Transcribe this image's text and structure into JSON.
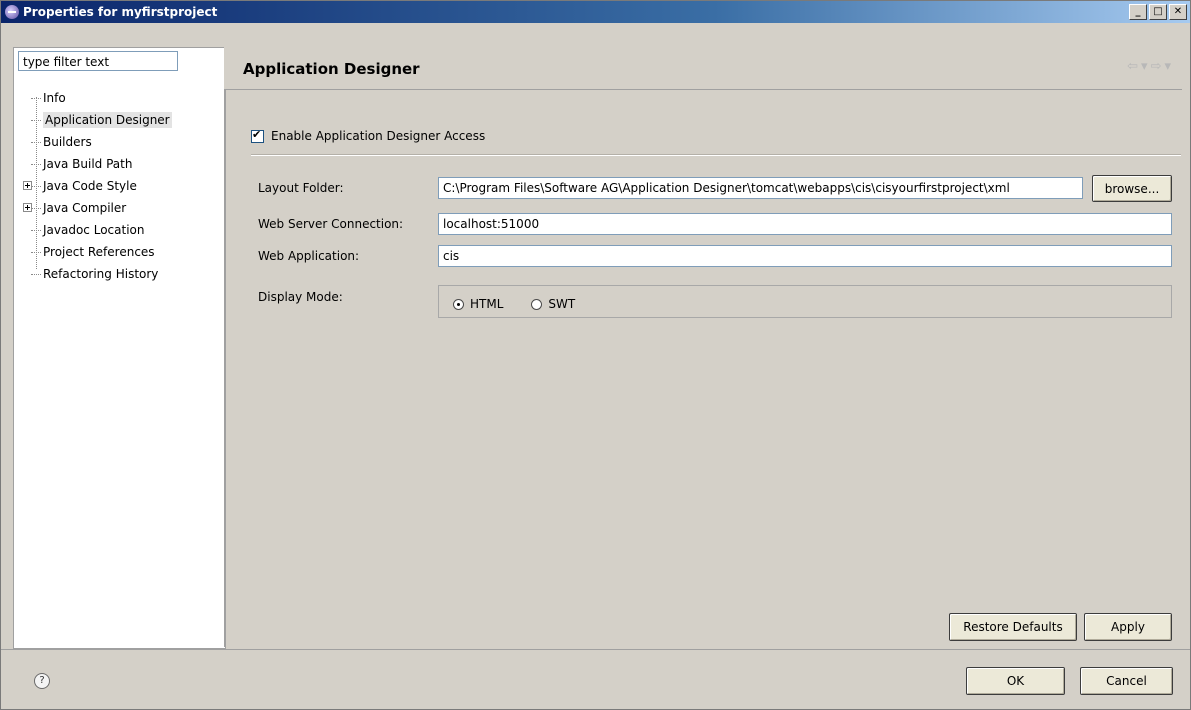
{
  "window": {
    "title": "Properties for myfirstproject"
  },
  "filter": {
    "placeholder": "type filter text"
  },
  "tree": {
    "items": [
      "Info",
      "Application Designer",
      "Builders",
      "Java Build Path",
      "Java Code Style",
      "Java Compiler",
      "Javadoc Location",
      "Project References",
      "Refactoring History"
    ]
  },
  "page": {
    "title": "Application Designer",
    "enable_label": "Enable Application Designer Access",
    "layout_folder_label": "Layout Folder:",
    "layout_folder_value": "C:\\Program Files\\Software AG\\Application Designer\\tomcat\\webapps\\cis\\cisyourfirstproject\\xml",
    "browse_label": "browse...",
    "web_server_label": "Web Server Connection:",
    "web_server_value": "localhost:51000",
    "web_app_label": "Web Application:",
    "web_app_value": "cis",
    "display_mode_label": "Display Mode:",
    "mode_html": "HTML",
    "mode_swt": "SWT"
  },
  "buttons": {
    "restore_defaults": "Restore Defaults",
    "apply": "Apply",
    "ok": "OK",
    "cancel": "Cancel"
  },
  "icons": {
    "title": "eclipse-icon",
    "help": "help-icon"
  }
}
